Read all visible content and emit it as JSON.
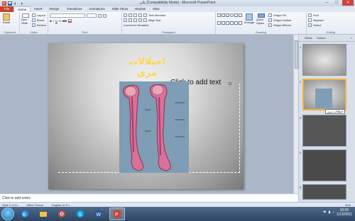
{
  "window": {
    "title": "بلایر [Compatibility Mode] - Microsoft PowerPoint"
  },
  "tabs": [
    "File",
    "Home",
    "Insert",
    "Design",
    "Transitions",
    "Animations",
    "Slide Show",
    "Review",
    "View"
  ],
  "ribbon": {
    "groups": {
      "clipboard": "Clipboard",
      "slides": "Slides",
      "font": "Font",
      "paragraph": "Paragraph",
      "drawing": "Drawing",
      "editing": "Editing"
    },
    "paste_label": "Paste",
    "new_slide_label": "New Slide",
    "layout_label": "Layout",
    "reset_label": "Reset",
    "section_label": "Section",
    "text_direction_label": "Text Direction",
    "align_text_label": "Align Text",
    "convert_smartart_label": "Convert to SmartArt",
    "arrange_label": "Arrange",
    "quick_styles_label": "Quick Styles",
    "shape_fill_label": "Shape Fill",
    "shape_outline_label": "Shape Outline",
    "shape_effects_label": "Shape Effects",
    "find_label": "Find",
    "replace_label": "Replace",
    "select_label": "Select"
  },
  "slide": {
    "title": "اختلالات مری",
    "placeholder": "Click to add text"
  },
  "notes": {
    "placeholder": "Click to add notes"
  },
  "panel": {
    "tabs": [
      "Slides",
      "Outline"
    ],
    "tooltip": "اختلالات مری",
    "slide_numbers": [
      "1",
      "2",
      "3",
      "4",
      "5"
    ]
  },
  "statusbar": {
    "slide_info": "Slide 2 of 14",
    "theme": "Office Theme",
    "language": "English (U.S.)",
    "zoom": "50%"
  },
  "taskbar": {
    "time": "10:05",
    "date": "1/12/2021"
  },
  "colors": {
    "title_color": "#ffd54a",
    "file_tab": "#c7432c",
    "selection": "#f0b537"
  }
}
